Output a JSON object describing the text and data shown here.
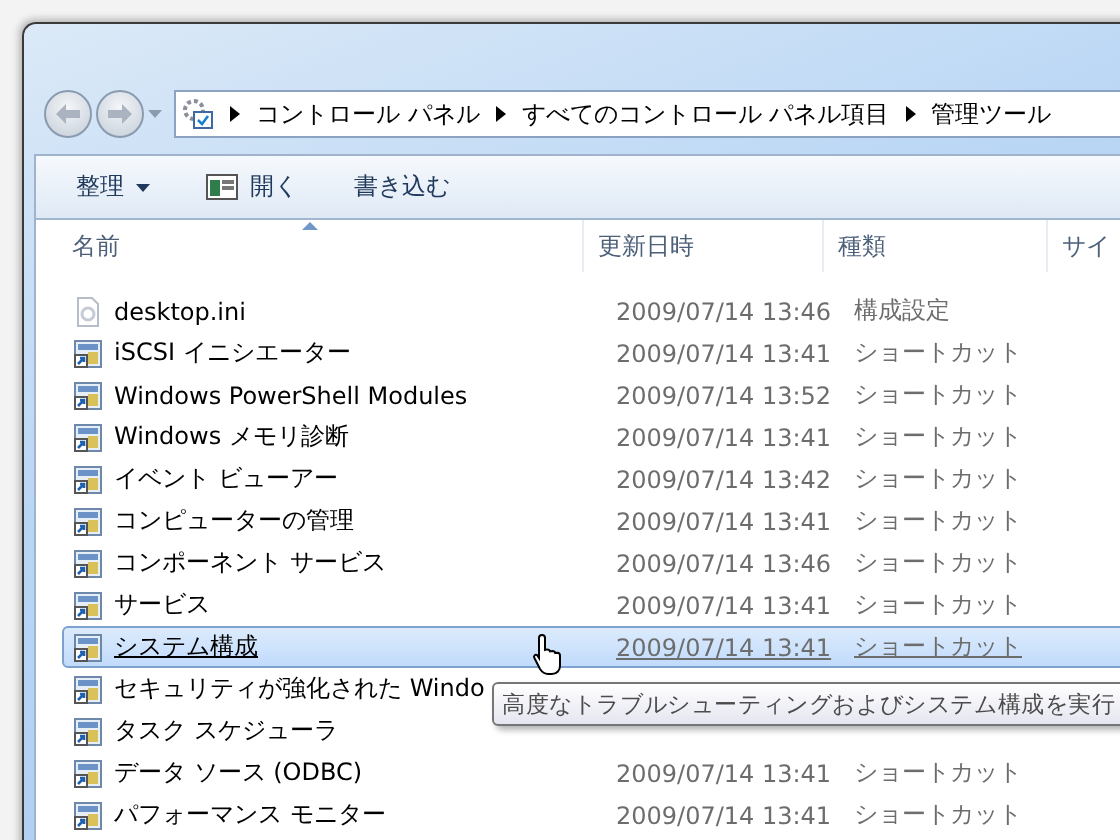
{
  "nav": {
    "breadcrumb": [
      "コントロール パネル",
      "すべてのコントロール パネル項目",
      "管理ツール"
    ]
  },
  "toolbar": [
    {
      "label": "整理",
      "kind": "menu"
    },
    {
      "label": "開く",
      "kind": "icon"
    },
    {
      "label": "書き込む",
      "kind": "plain"
    }
  ],
  "columns": [
    {
      "label": "名前",
      "sorted": true
    },
    {
      "label": "更新日時",
      "sorted": false
    },
    {
      "label": "種類",
      "sorted": false
    },
    {
      "label": "サイ",
      "sorted": false
    }
  ],
  "rows": [
    {
      "name": "desktop.ini",
      "date": "2009/07/14 13:46",
      "type": "構成設定",
      "kind": "file",
      "selected": false
    },
    {
      "name": "iSCSI イニシエーター",
      "date": "2009/07/14 13:41",
      "type": "ショートカット",
      "kind": "shortcut",
      "selected": false
    },
    {
      "name": "Windows PowerShell Modules",
      "date": "2009/07/14 13:52",
      "type": "ショートカット",
      "kind": "shortcut",
      "selected": false
    },
    {
      "name": "Windows メモリ診断",
      "date": "2009/07/14 13:41",
      "type": "ショートカット",
      "kind": "shortcut",
      "selected": false
    },
    {
      "name": "イベント ビューアー",
      "date": "2009/07/14 13:42",
      "type": "ショートカット",
      "kind": "shortcut",
      "selected": false
    },
    {
      "name": "コンピューターの管理",
      "date": "2009/07/14 13:41",
      "type": "ショートカット",
      "kind": "shortcut",
      "selected": false
    },
    {
      "name": "コンポーネント サービス",
      "date": "2009/07/14 13:46",
      "type": "ショートカット",
      "kind": "shortcut",
      "selected": false
    },
    {
      "name": "サービス",
      "date": "2009/07/14 13:41",
      "type": "ショートカット",
      "kind": "shortcut",
      "selected": false
    },
    {
      "name": "システム構成",
      "date": "2009/07/14 13:41",
      "type": "ショートカット",
      "kind": "shortcut",
      "selected": true
    },
    {
      "name": "セキュリティが強化された Windo",
      "kind": "shortcut",
      "selected": false
    },
    {
      "name": "タスク スケジューラ",
      "kind": "shortcut",
      "selected": false
    },
    {
      "name": "データ ソース (ODBC)",
      "date": "2009/07/14 13:41",
      "type": "ショートカット",
      "kind": "shortcut",
      "selected": false
    },
    {
      "name": "パフォーマンス モニター",
      "date": "2009/07/14 13:41",
      "type": "ショートカット",
      "kind": "shortcut",
      "selected": false
    }
  ],
  "tooltip": {
    "text": "高度なトラブルシューティングおよびシステム構成を実行"
  }
}
